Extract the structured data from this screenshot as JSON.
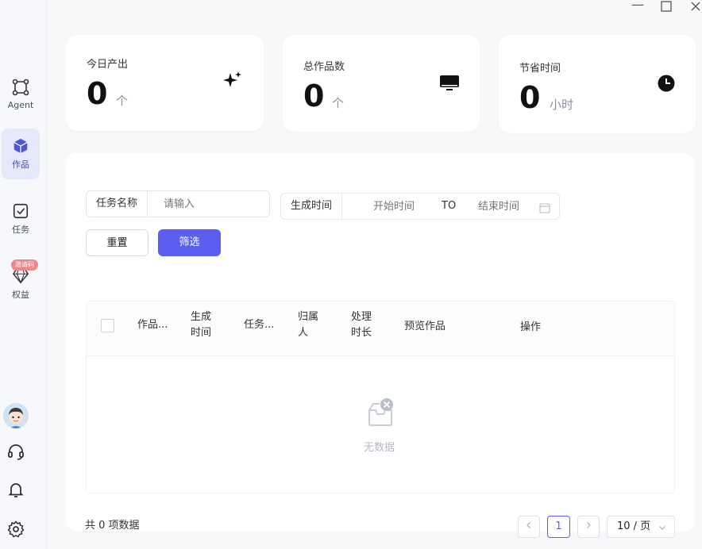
{
  "sidebar": {
    "items": [
      {
        "label": "Agent",
        "icon": "agent-icon"
      },
      {
        "label": "作品",
        "icon": "cube-icon",
        "active": true
      },
      {
        "label": "任务",
        "icon": "checkbox-icon"
      },
      {
        "label": "权益",
        "icon": "diamond-icon",
        "badge": "邀请码"
      }
    ],
    "bottom_icons": [
      "avatar",
      "headset-icon",
      "bell-icon",
      "gear-icon"
    ]
  },
  "stats": [
    {
      "label": "今日产出",
      "value": "0",
      "unit": "个",
      "icon": "sparkle-icon"
    },
    {
      "label": "总作品数",
      "value": "0",
      "unit": "个",
      "icon": "monitor-icon"
    },
    {
      "label": "节省时间",
      "value": "0",
      "unit": "小时",
      "icon": "clock-icon"
    }
  ],
  "filters": {
    "task_name_label": "任务名称",
    "task_name_placeholder": "请输入",
    "created_time_label": "生成时间",
    "start_placeholder": "开始时间",
    "to_label": "TO",
    "end_placeholder": "结束时间",
    "reset_label": "重置",
    "filter_label": "筛选"
  },
  "table": {
    "columns": [
      "作品...",
      "生成\n时间",
      "任务...",
      "归属\n人",
      "处理\n时长",
      "预览作品",
      "操作"
    ],
    "empty_text": "无数据"
  },
  "footer": {
    "total_text": "共 0 项数据",
    "current_page": "1",
    "page_size": "10 / 页"
  },
  "colors": {
    "accent": "#5b5ef0",
    "sidebar_active_bg": "#e6e8fb",
    "badge": "#f0868a"
  }
}
